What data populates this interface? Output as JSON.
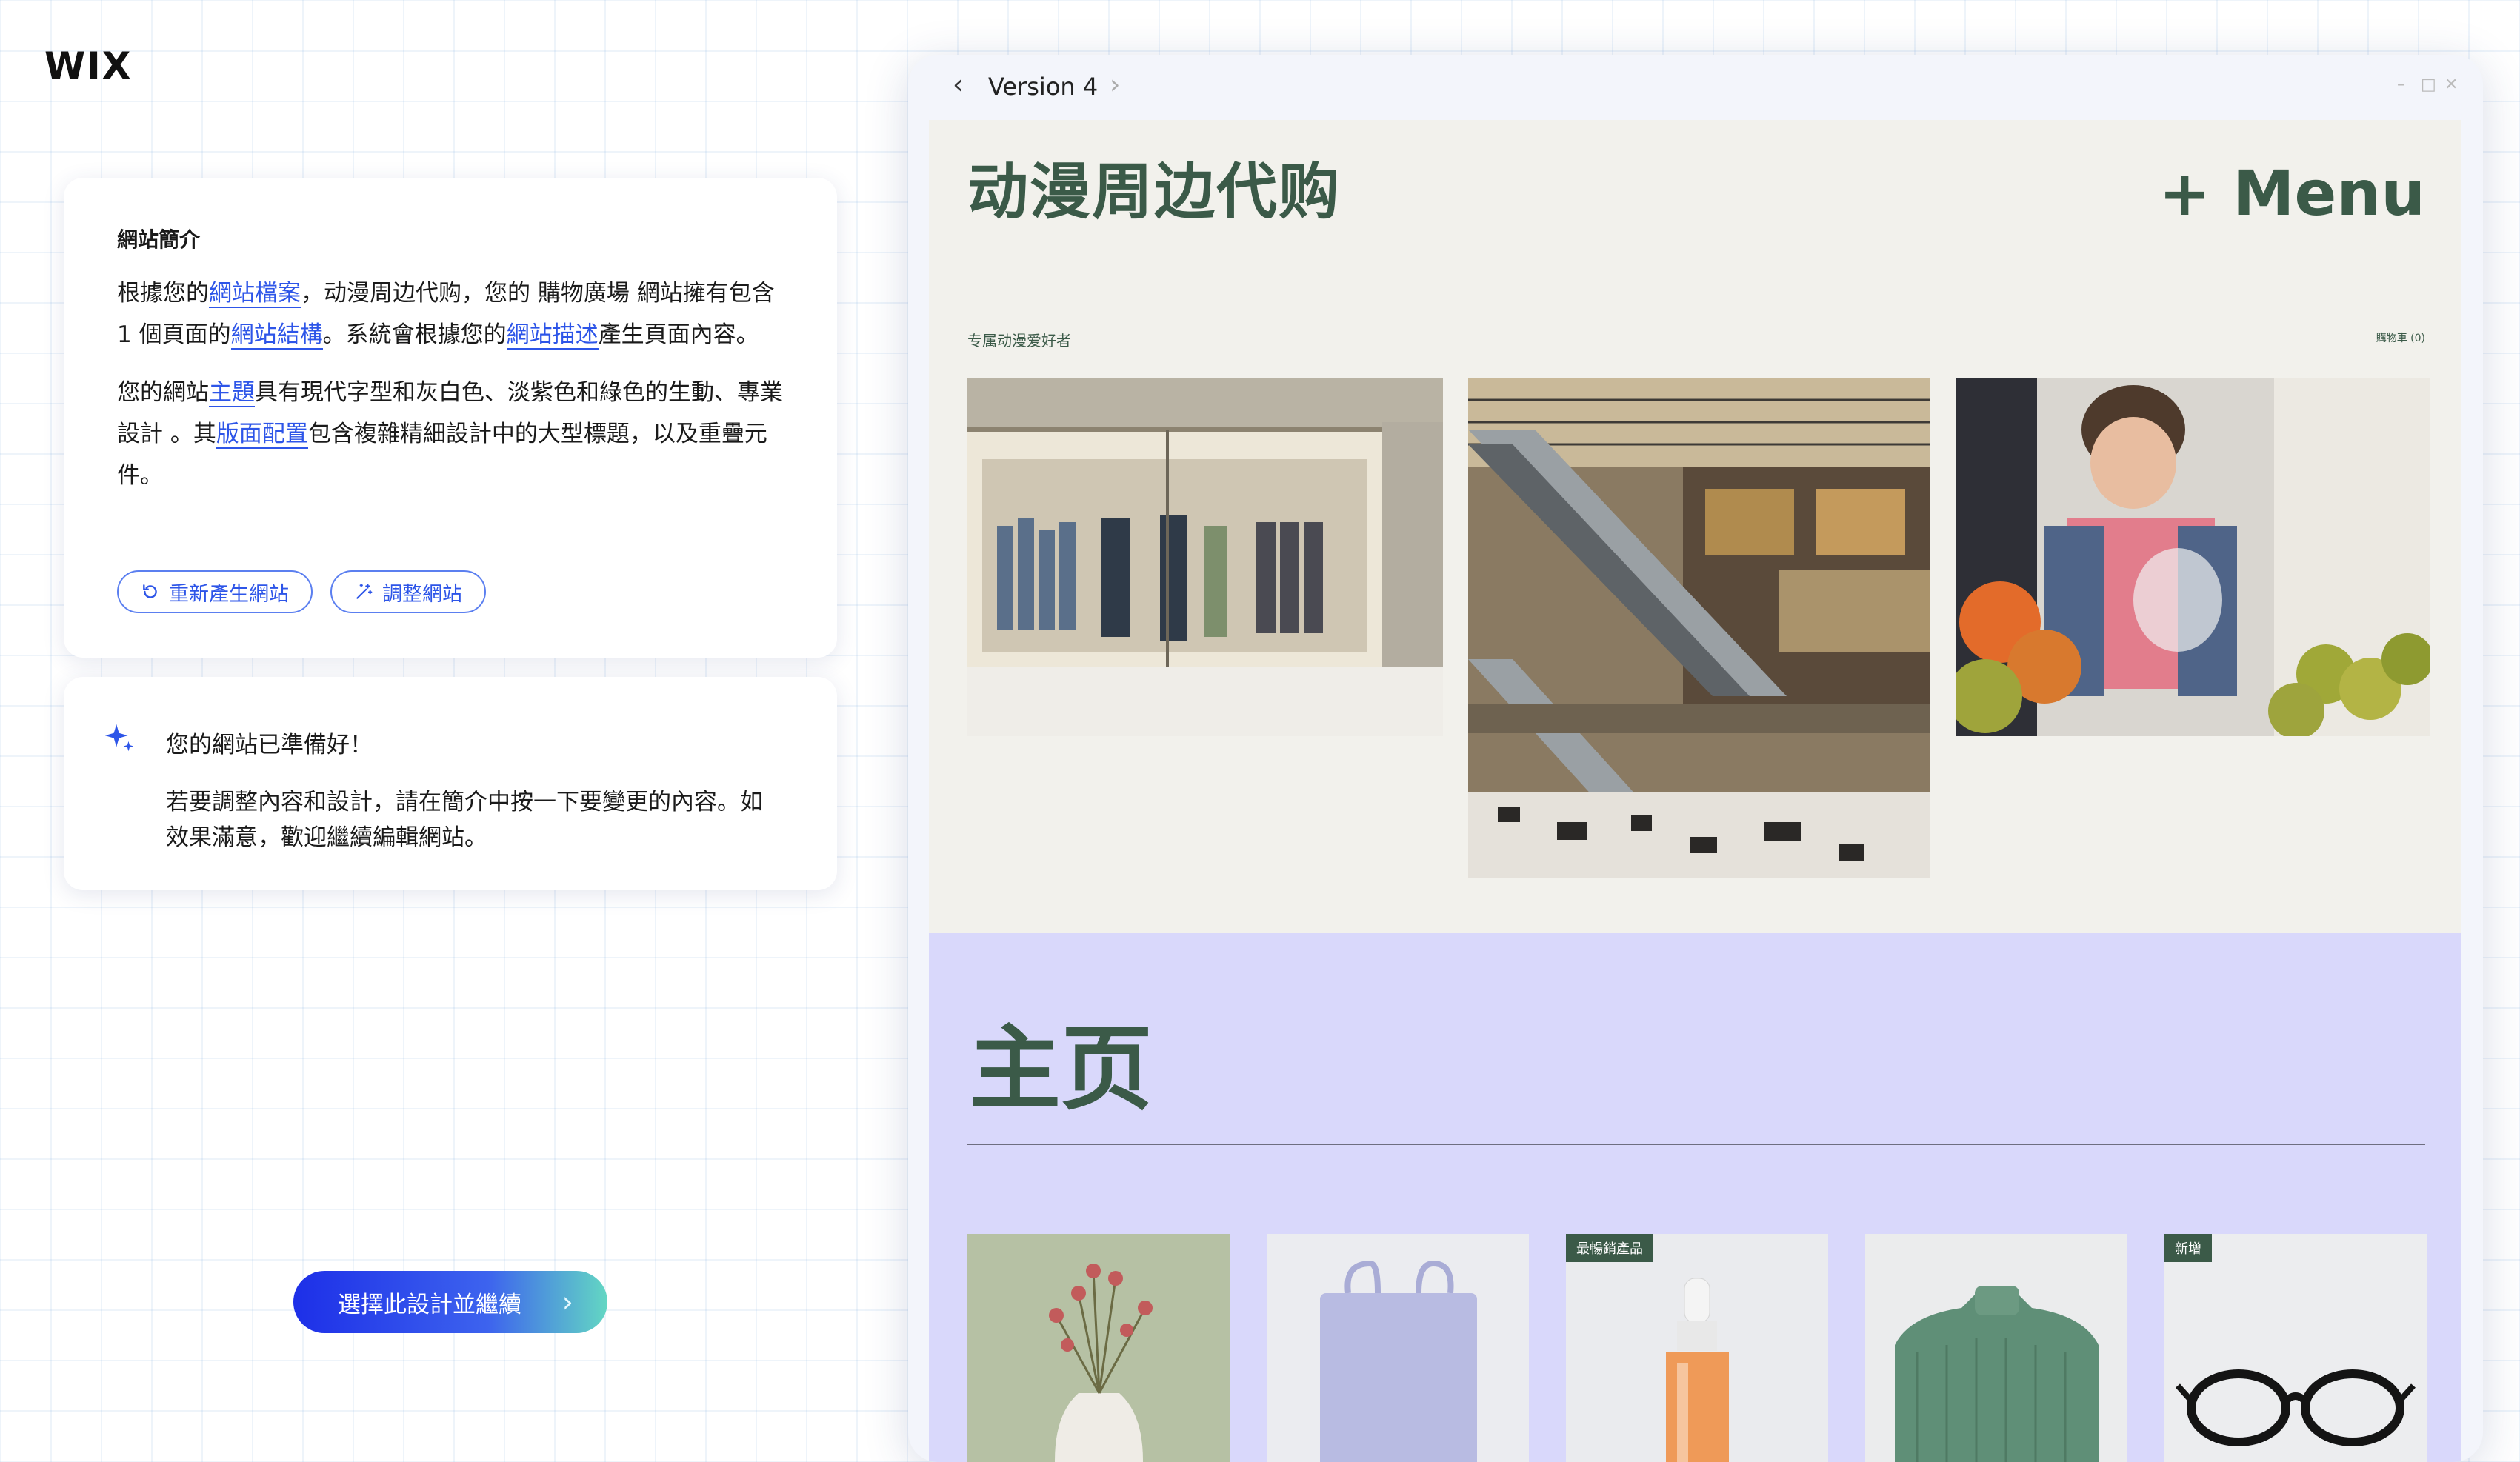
{
  "app": {
    "logo": "WIX"
  },
  "brief": {
    "title": "網站簡介",
    "p1": {
      "t1": "根據您的",
      "link1": "網站檔案",
      "t2": "，动漫周边代购，您的 購物廣場 網站擁有包含 1 個頁面的",
      "link2": "網站結構",
      "t3": "。系統會根據您的",
      "link3": "網站描述",
      "t4": "產生頁面內容。"
    },
    "p2": {
      "t1": "您的網站",
      "link1": "主題",
      "t2": "具有現代字型和灰白色、淡紫色和綠色的生動、專業設計 。其",
      "link2": "版面配置",
      "t3": "包含複雜精細設計中的大型標題，以及重疊元件。"
    },
    "regenerate_label": "重新產生網站",
    "adjust_label": "調整網站"
  },
  "ready": {
    "title": "您的網站已準備好！",
    "body": "若要調整內容和設計，請在簡介中按一下要變更的內容。如效果滿意，歡迎繼續編輯網站。"
  },
  "cta": {
    "label": "選擇此設計並繼續"
  },
  "preview": {
    "version_label": "Version 4",
    "site_title": "动漫周边代购",
    "menu_label": "+ Menu",
    "tagline": "专属动漫爱好者",
    "cart_label": "購物車 (0)",
    "home_title": "主页",
    "products": [
      {
        "name": "dried-flower-vase",
        "badge": ""
      },
      {
        "name": "lavender-tote-bag",
        "badge": ""
      },
      {
        "name": "serum-bottle",
        "badge": "最暢銷產品"
      },
      {
        "name": "green-knit-sweater",
        "badge": ""
      },
      {
        "name": "black-eyeglasses",
        "badge": "新增"
      }
    ]
  },
  "colors": {
    "accent_blue": "#2d55e8",
    "site_green": "#3b5a48",
    "hero_bg": "#f2f1ec",
    "home_bg": "#d9d8fb"
  },
  "icons": [
    "refresh-icon",
    "magic-wand-icon",
    "sparkle-icon",
    "chevron-left-icon",
    "chevron-right-icon",
    "minimize-icon",
    "maximize-icon",
    "close-icon"
  ]
}
